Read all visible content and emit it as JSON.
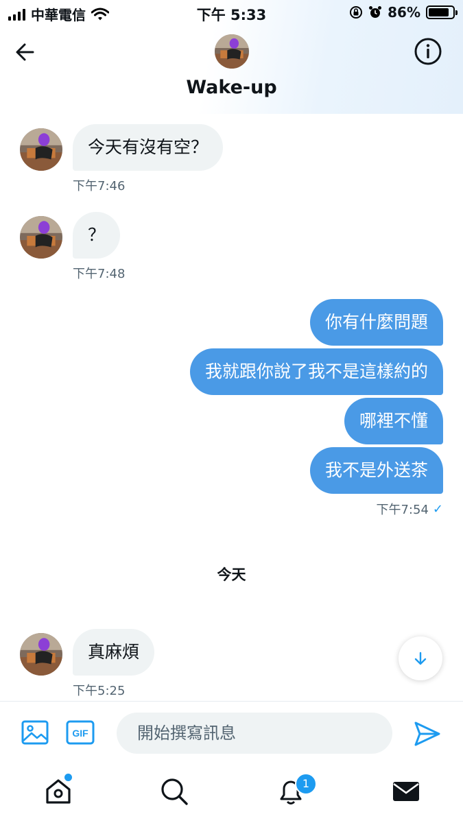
{
  "status_bar": {
    "carrier": "中華電信",
    "time": "下午 5:33",
    "battery": "86%",
    "battery_level": 0.86
  },
  "header": {
    "title": "Wake-up",
    "back_icon": "arrow-left-icon",
    "info_icon": "info-icon"
  },
  "messages": [
    {
      "direction": "in",
      "text": "今天有沒有空？",
      "time": "下午7:46"
    },
    {
      "direction": "in",
      "text": "？",
      "time": "下午7:48"
    },
    {
      "direction": "out",
      "text": "你有什麼問題"
    },
    {
      "direction": "out",
      "text": "我就跟你說了我不是這樣約的"
    },
    {
      "direction": "out",
      "text": "哪裡不懂"
    },
    {
      "direction": "out",
      "text": "我不是外送茶",
      "time": "下午7:54"
    }
  ],
  "day_separator": "今天",
  "latest_message": {
    "direction": "in",
    "text": "真麻煩",
    "time": "下午5:25"
  },
  "composer": {
    "placeholder": "開始撰寫訊息",
    "gif_label": "GIF"
  },
  "tabs": [
    {
      "name": "home",
      "icon": "home-icon"
    },
    {
      "name": "search",
      "icon": "search-icon"
    },
    {
      "name": "notifications",
      "icon": "bell-icon",
      "badge": "1"
    },
    {
      "name": "messages",
      "icon": "mail-icon"
    }
  ],
  "colors": {
    "accent": "#1d9bf0",
    "outgoing_bubble": "#4a9ae6",
    "incoming_bubble": "#eff3f4"
  }
}
